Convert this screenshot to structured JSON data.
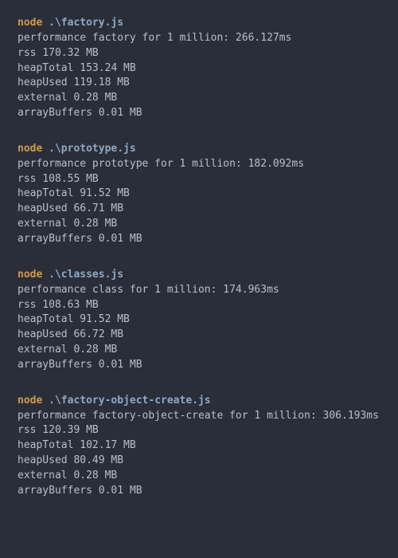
{
  "blocks": [
    {
      "cmd_exec": "node",
      "cmd_arg": ".\\factory.js",
      "perf_line": "performance factory for 1 million: 266.127ms",
      "rss_line": "rss 170.32 MB",
      "heapTotal_line": "heapTotal 153.24 MB",
      "heapUsed_line": "heapUsed 119.18 MB",
      "external_line": "external 0.28 MB",
      "arrayBuffers_line": "arrayBuffers 0.01 MB"
    },
    {
      "cmd_exec": "node",
      "cmd_arg": ".\\prototype.js",
      "perf_line": "performance prototype for 1 million: 182.092ms",
      "rss_line": "rss 108.55 MB",
      "heapTotal_line": "heapTotal 91.52 MB",
      "heapUsed_line": "heapUsed 66.71 MB",
      "external_line": "external 0.28 MB",
      "arrayBuffers_line": "arrayBuffers 0.01 MB"
    },
    {
      "cmd_exec": "node",
      "cmd_arg": ".\\classes.js",
      "perf_line": "performance class for 1 million: 174.963ms",
      "rss_line": "rss 108.63 MB",
      "heapTotal_line": "heapTotal 91.52 MB",
      "heapUsed_line": "heapUsed 66.72 MB",
      "external_line": "external 0.28 MB",
      "arrayBuffers_line": "arrayBuffers 0.01 MB"
    },
    {
      "cmd_exec": "node",
      "cmd_arg": ".\\factory-object-create.js",
      "perf_line": "performance factory-object-create for 1 million: 306.193ms",
      "rss_line": "rss 120.39 MB",
      "heapTotal_line": "heapTotal 102.17 MB",
      "heapUsed_line": "heapUsed 80.49 MB",
      "external_line": "external 0.28 MB",
      "arrayBuffers_line": "arrayBuffers 0.01 MB"
    }
  ]
}
